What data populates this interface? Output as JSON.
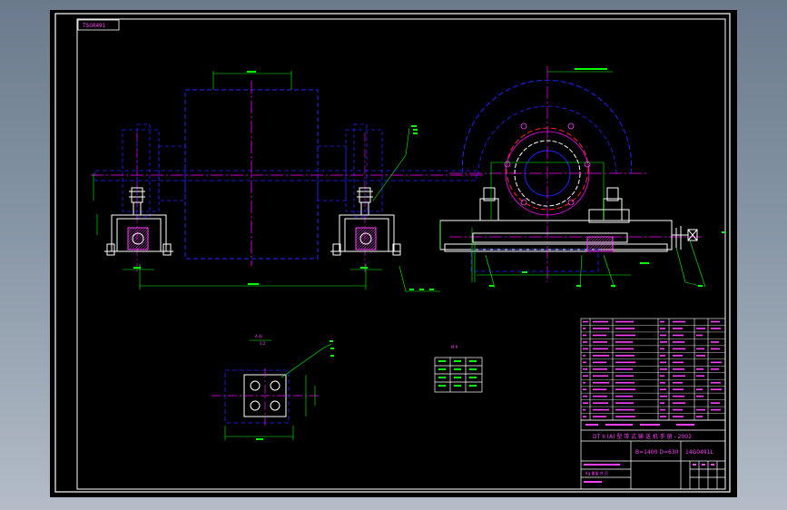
{
  "drawing": {
    "drawing_code": "TSG0491",
    "title_block": {
      "title_line": "DT II (A) 型 带 式 输 送 机 手 册 - 2002",
      "spec_line": "B=1400 D=630",
      "spec_code": "14G0491L",
      "footer_note": "Kg  重量 共 页"
    },
    "view_labels": {
      "detail_label": "A 向",
      "detail_scale": "1:2",
      "table_heading": "M  R"
    },
    "colors": {
      "background": "#000000",
      "border": "#ffffff",
      "outline": "#ffffff",
      "centerline": "#ff00ff",
      "hidden": "#2323ff",
      "dimension": "#00ff00",
      "text": "#ff40ff",
      "pulley": "#0000ff"
    }
  }
}
